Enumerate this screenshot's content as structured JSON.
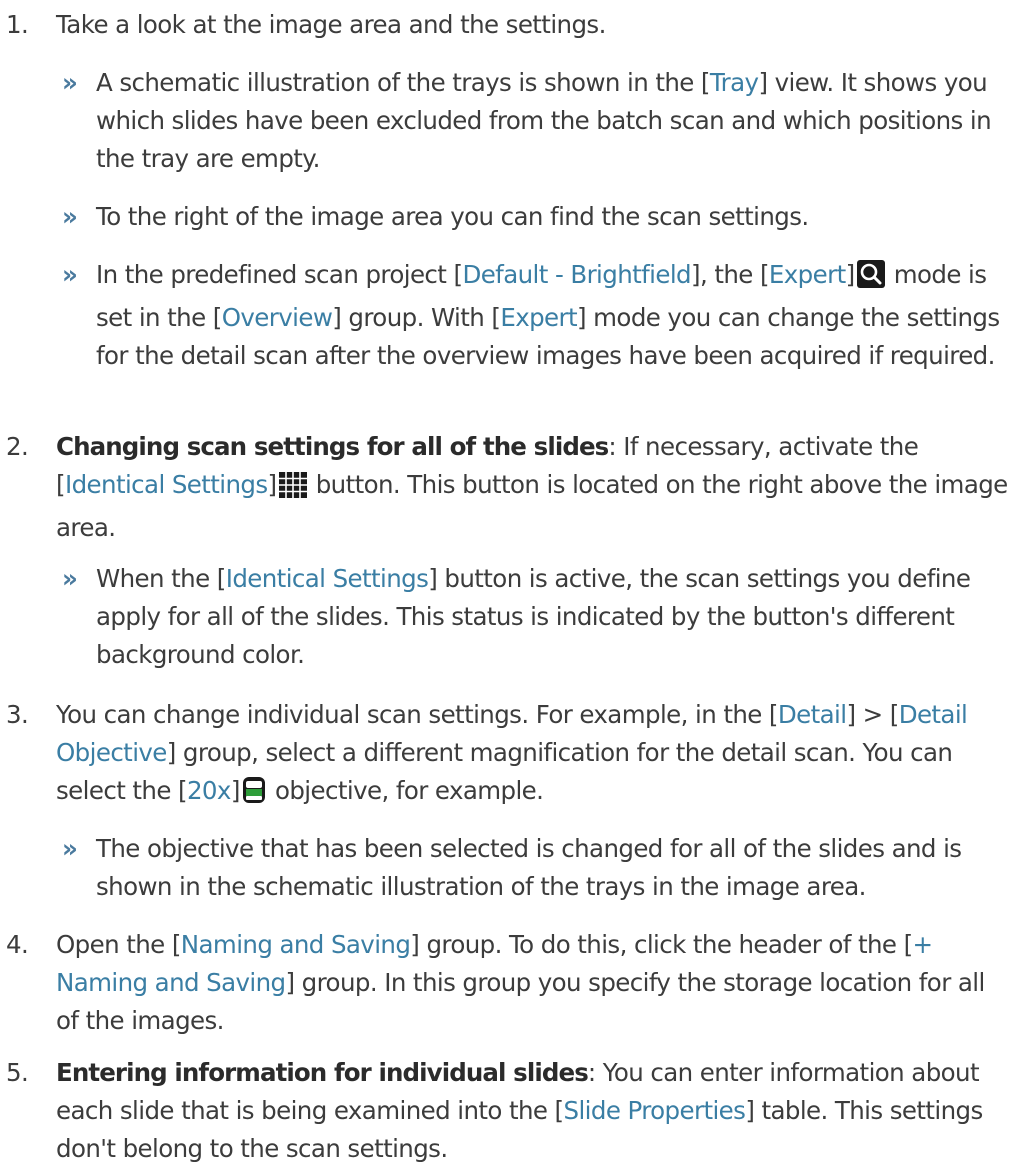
{
  "steps": [
    {
      "num": "1.",
      "pre": "Take a look at the image area and the settings."
    },
    {
      "num": "2.",
      "bold": "Changing scan settings for all of the slides",
      "a": ": If necessary, activate the [",
      "ui1": "Identical Settings",
      "b": "]",
      "c": " button. This button is located on the right above the image area."
    },
    {
      "num": "3.",
      "a": "You can change individual scan settings. For example, in the [",
      "ui1": "Detail",
      "b": "] > [",
      "ui2": "Detail Objective",
      "c": "] group, select a different magnification for the detail scan. You can select the [",
      "ui3": "20x",
      "d": "]",
      "e": " objective, for example."
    },
    {
      "num": "4.",
      "a": "Open the [",
      "ui1": "Naming and Saving",
      "b": "] group. To do this, click the header of the [",
      "ui2": "+ Naming and Saving",
      "c": "] group. In this group you specify the storage location for all of the images."
    },
    {
      "num": "5.",
      "bold": "Entering information for individual slides",
      "a": ": You can enter information about each slide that is being examined into the [",
      "ui1": "Slide Properties",
      "b": "] table. This settings don't belong to the scan settings."
    }
  ],
  "results": [
    {
      "marker": "»",
      "a": "A schematic illustration of the trays is shown in the [",
      "ui1": "Tray",
      "b": "] view. It shows you which slides have been excluded from the batch scan and which positions in the tray are empty."
    },
    {
      "marker": "»",
      "a": "To the right of the image area you can find the scan settings."
    },
    {
      "marker": "»",
      "a": "In the predefined scan project [",
      "ui1": "Default - Brightfield",
      "b": "], the [",
      "ui2": "Expert",
      "c": "]",
      "d": " mode is set in the [",
      "ui3": "Overview",
      "e": "] group. With [",
      "ui4": "Expert",
      "f": "] mode you can change the settings for the detail scan after the overview images have been acquired if required."
    },
    {
      "marker": "»",
      "a": "When the [",
      "ui1": "Identical Settings",
      "b": "] button is active, the scan settings you define apply for all of the slides. This status is indicated by the button's different background color."
    },
    {
      "marker": "»",
      "a": "The objective that has been selected is changed for all of the slides and is shown in the schematic illustration of the trays in the image area."
    }
  ],
  "icons": {
    "expert": "magnifier-icon",
    "identical_settings": "grid-icon",
    "objective": "objective-icon",
    "accent": "#3a7ea4"
  }
}
